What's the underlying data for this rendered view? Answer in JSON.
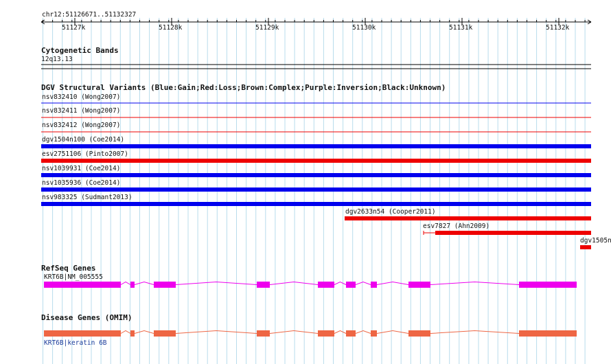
{
  "location": "chr12:51126671..51132327",
  "ruler": {
    "ticks": [
      "51127k",
      "51128k",
      "51129k",
      "51130k",
      "51131k",
      "51132k"
    ]
  },
  "tracks": {
    "cytogenetic": {
      "title": "Cytogenetic Bands",
      "band": "12q13.13"
    },
    "dgv": {
      "title": "DGV Structural Variants (Blue:Gain;Red:Loss;Brown:Complex;Purple:Inversion;Black:Unknown)",
      "features": [
        {
          "label": "nsv832410 (Wong2007)",
          "type": "gain",
          "style": "thin"
        },
        {
          "label": "nsv832411 (Wong2007)",
          "type": "loss",
          "style": "thin"
        },
        {
          "label": "nsv832412 (Wong2007)",
          "type": "loss",
          "style": "thin"
        },
        {
          "label": "dgv1504n100 (Coe2014)",
          "type": "gain",
          "style": "thick"
        },
        {
          "label": "esv2751106 (Pinto2007)",
          "type": "loss",
          "style": "thick"
        },
        {
          "label": "nsv1039931 (Coe2014)",
          "type": "gain",
          "style": "thick"
        },
        {
          "label": "nsv1035936 (Coe2014)",
          "type": "gain",
          "style": "thick"
        },
        {
          "label": "nsv983325 (Sudmant2013)",
          "type": "gain",
          "style": "thick"
        },
        {
          "label": "dgv2633n54 (Cooper2011)",
          "type": "loss",
          "style": "thick"
        },
        {
          "label": "esv7827 (Ahn2009)",
          "type": "loss",
          "style": "thick"
        },
        {
          "label": "dgv1505n",
          "type": "loss",
          "style": "thick"
        }
      ]
    },
    "refseq": {
      "title": "RefSeq Genes",
      "gene_label": "KRT6B|NM_005555"
    },
    "omim": {
      "title": "Disease Genes (OMIM)",
      "gene_label": "KRT6B|keratin 6B"
    }
  },
  "colors": {
    "gain": "#0000ee",
    "loss": "#ee0000",
    "refseq": "#ee00ee",
    "omim": "#ee6644",
    "grid": "#b8dcec",
    "link": "#1a3a9a"
  }
}
